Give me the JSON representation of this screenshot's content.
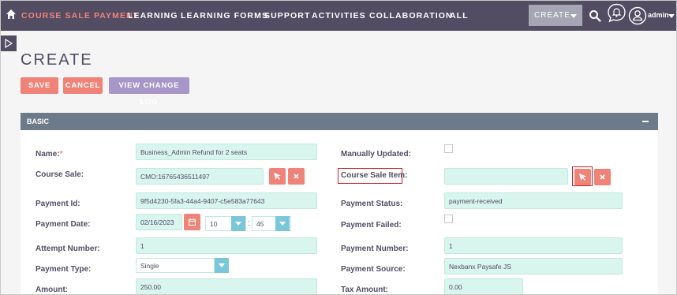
{
  "nav": {
    "items": [
      "COURSE SALE PAYMENT",
      "LEARNING",
      "LEARNING FORMS",
      "SUPPORT",
      "ACTIVITIES",
      "COLLABORATION",
      "ALL"
    ],
    "create_label": "CREATE",
    "user_name": "admin"
  },
  "page": {
    "title": "CREATE",
    "save_label": "SAVE",
    "cancel_label": "CANCEL",
    "log_label": "VIEW CHANGE LOG"
  },
  "panel": {
    "title": "BASIC"
  },
  "fields": {
    "name": {
      "label": "Name:",
      "required_mark": "*",
      "value": "Business_Admin Refund for 2 seats"
    },
    "manually_updated": {
      "label": "Manually Updated:"
    },
    "course_sale": {
      "label": "Course Sale:",
      "value": "CMO:16765436511497"
    },
    "course_sale_item": {
      "label": "Course Sale Item:",
      "value": ""
    },
    "payment_id": {
      "label": "Payment Id:",
      "value": "9f5d4230-5fa3-44a4-9407-c5e583a77643"
    },
    "payment_status": {
      "label": "Payment Status:",
      "value": "payment-received"
    },
    "payment_date": {
      "label": "Payment Date:",
      "date": "02/16/2023",
      "hour": "10",
      "minute": "45",
      "separator": ":"
    },
    "payment_failed": {
      "label": "Payment Failed:"
    },
    "attempt_number": {
      "label": "Attempt Number:",
      "value": "1"
    },
    "payment_number": {
      "label": "Payment Number:",
      "value": "1"
    },
    "payment_type": {
      "label": "Payment Type:",
      "value": "Single"
    },
    "payment_source": {
      "label": "Payment Source:",
      "value": "Nexbanx Paysafe JS"
    },
    "amount": {
      "label": "Amount:",
      "value": "250.00"
    },
    "tax_amount": {
      "label": "Tax Amount:",
      "value": "0.00"
    }
  },
  "colors": {
    "nav_bg": "#534d64",
    "accent": "#f08377",
    "panel_head": "#6c7a89",
    "field_bg": "#d8f5ee",
    "highlight": "#d0222b"
  },
  "icons": [
    "home-icon",
    "search-icon",
    "bell-icon",
    "user-icon",
    "sidebar-toggle-icon",
    "cursor-select-icon",
    "clear-x-icon",
    "calendar-icon",
    "chevron-down-icon",
    "minus-icon"
  ]
}
